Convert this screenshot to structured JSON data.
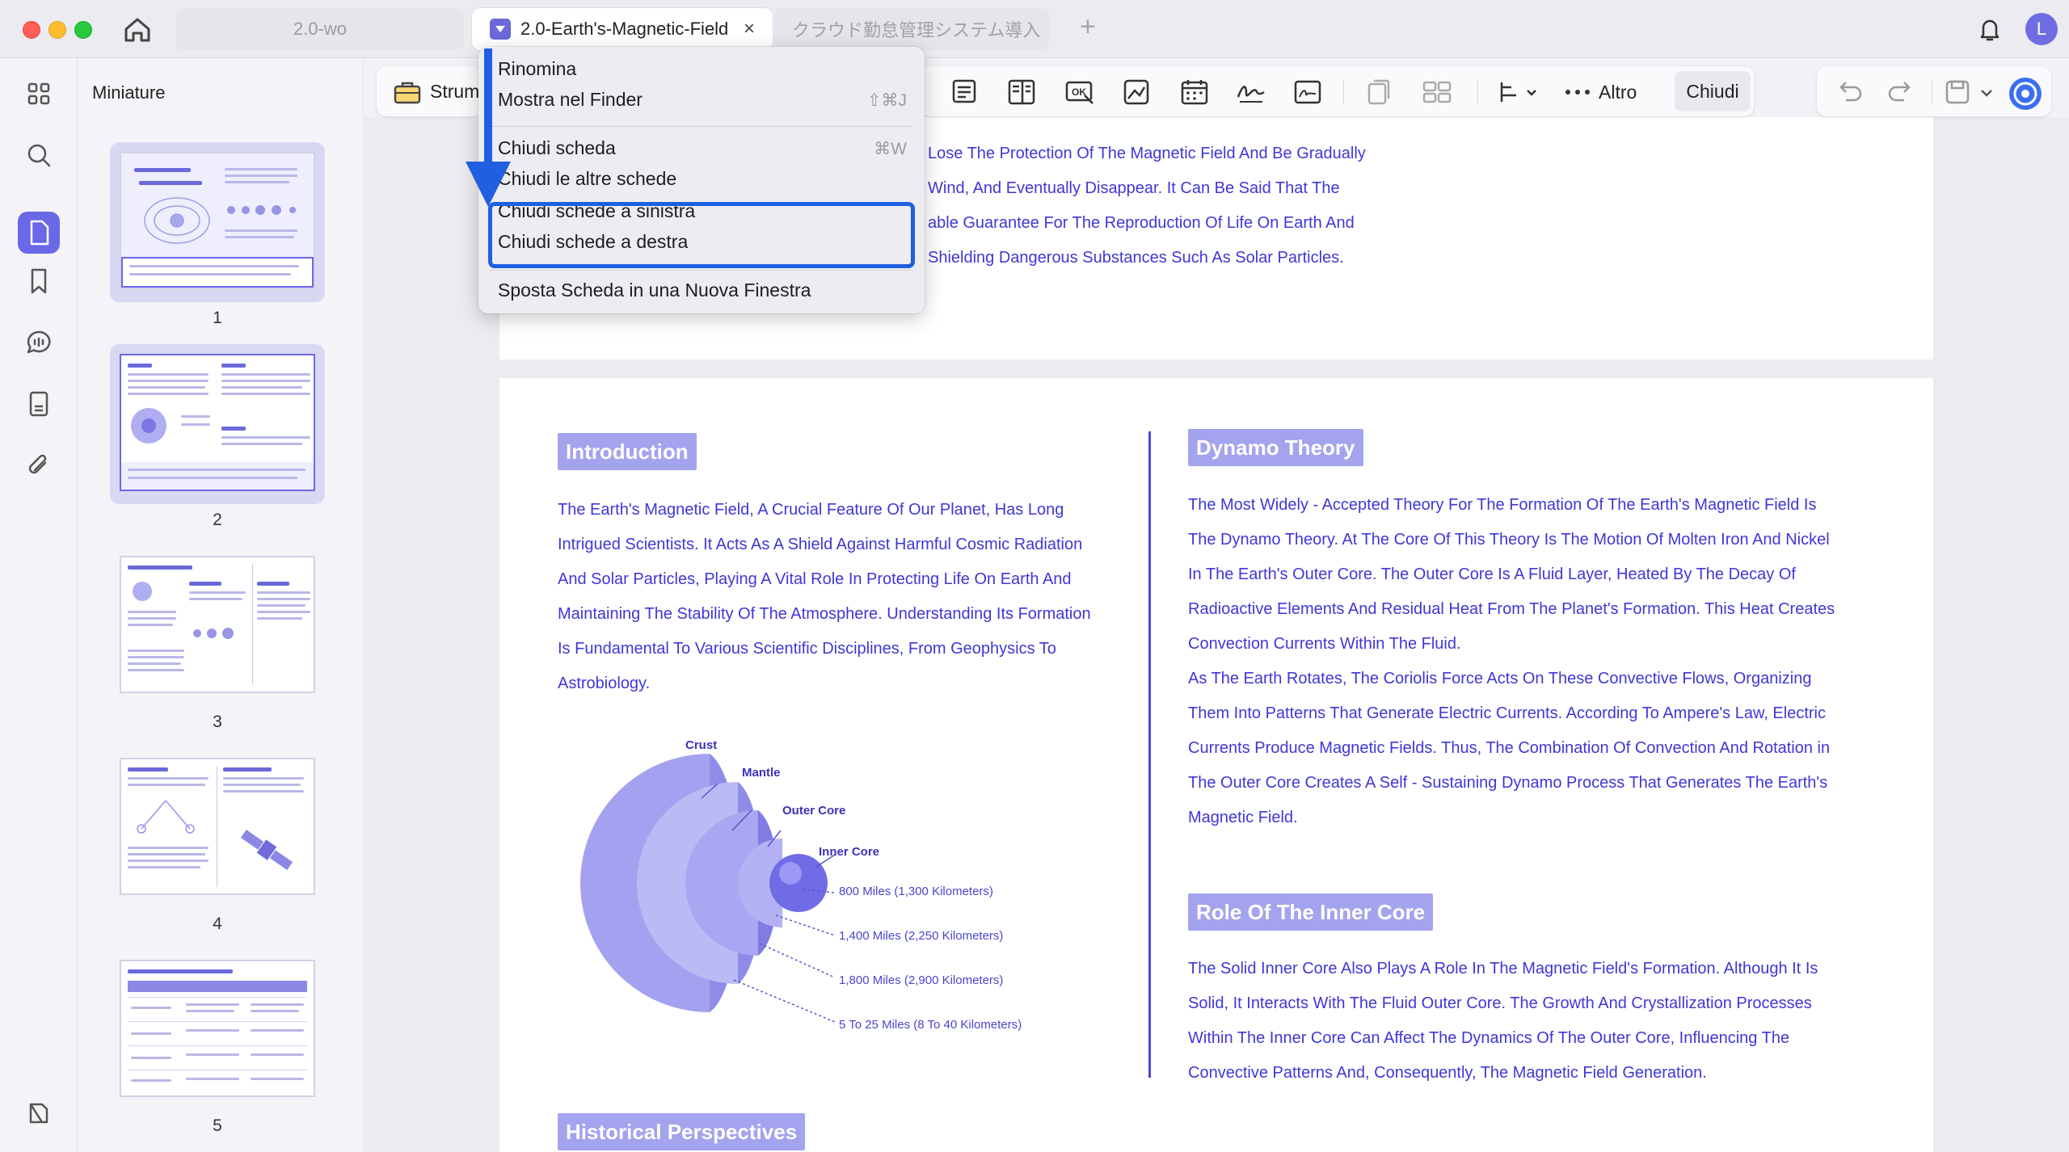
{
  "tabs": [
    {
      "label": "2.0-wo"
    },
    {
      "label": "2.0-Earth's-Magnetic-Field",
      "close": "×"
    },
    {
      "label": "クラウド勤怠管理システム導入"
    }
  ],
  "new_tab": "+",
  "user_initial": "L",
  "thumbnails": {
    "title": "Miniature",
    "pages": [
      "1",
      "2",
      "3",
      "4",
      "5"
    ]
  },
  "toolbar": {
    "tools_label": "Strum",
    "more_label": "Altro",
    "close_label": "Chiudi"
  },
  "context_menu": {
    "items": [
      {
        "label": "Rinomina",
        "shortcut": ""
      },
      {
        "label": "Mostra nel Finder",
        "shortcut": "⇧⌘J"
      },
      {
        "label": "Chiudi scheda",
        "shortcut": "⌘W"
      },
      {
        "label": "Chiudi le altre schede",
        "shortcut": ""
      },
      {
        "label": "Chiudi schede a sinistra",
        "shortcut": ""
      },
      {
        "label": "Chiudi schede a destra",
        "shortcut": ""
      },
      {
        "label": "Sposta Scheda in una Nuova Finestra",
        "shortcut": ""
      }
    ]
  },
  "document": {
    "page1_lines": [
      "Lose The Protection Of The Magnetic Field And Be Gradually",
      "Wind, And Eventually Disappear. It Can Be Said That The",
      "able Guarantee For The Reproduction Of Life On Earth And",
      "Shielding Dangerous Substances Such As Solar Particles."
    ],
    "intro": {
      "heading": "Introduction",
      "lines": [
        "The Earth's Magnetic Field, A Crucial Feature Of Our Planet, Has Long",
        "Intrigued Scientists. It Acts As A Shield Against Harmful Cosmic Radiation",
        "And Solar Particles, Playing A Vital Role In Protecting Life On Earth And",
        "Maintaining The Stability Of The Atmosphere. Understanding Its Formation",
        "Is Fundamental To Various Scientific Disciplines, From Geophysics To",
        "Astrobiology."
      ]
    },
    "diagram": {
      "labels": [
        "Crust",
        "Mantle",
        "Outer Core",
        "Inner Core"
      ],
      "distances": [
        "800 Miles (1,300 Kilometers)",
        "1,400 Miles (2,250 Kilometers)",
        "1,800 Miles (2,900 Kilometers)",
        "5 To 25 Miles (8 To 40 Kilometers)"
      ]
    },
    "dynamo": {
      "heading": "Dynamo Theory",
      "lines": [
        "The Most Widely - Accepted Theory For The Formation Of The Earth's Magnetic Field Is",
        "The Dynamo Theory. At The Core Of This Theory Is The Motion Of Molten Iron And Nickel",
        "In The Earth's Outer Core. The Outer Core Is A Fluid Layer, Heated By The Decay Of",
        "Radioactive Elements And Residual Heat From The Planet's Formation. This Heat Creates",
        "Convection Currents Within The Fluid.",
        "As The Earth Rotates, The Coriolis Force Acts On These Convective Flows, Organizing",
        "Them Into Patterns That Generate Electric Currents. According To Ampere's Law, Electric",
        "Currents Produce Magnetic Fields. Thus, The Combination Of Convection And Rotation in",
        "The Outer Core Creates A Self - Sustaining Dynamo Process That Generates The Earth's",
        "Magnetic Field."
      ]
    },
    "inner_core": {
      "heading": "Role Of The Inner Core",
      "lines": [
        "The Solid Inner Core Also Plays A Role In The Magnetic Field's Formation. Although It Is",
        "Solid, It Interacts With The Fluid Outer Core. The Growth And Crystallization Processes",
        "Within The Inner Core Can Affect The Dynamics Of The Outer Core, Influencing The",
        "Convective Patterns And, Consequently, The Magnetic Field Generation."
      ]
    },
    "historical": {
      "heading": "Historical Perspectives"
    }
  },
  "colors": {
    "accent": "#6b68e8",
    "text": "#3f37d6",
    "highlight_box": "#1f5fe0"
  }
}
